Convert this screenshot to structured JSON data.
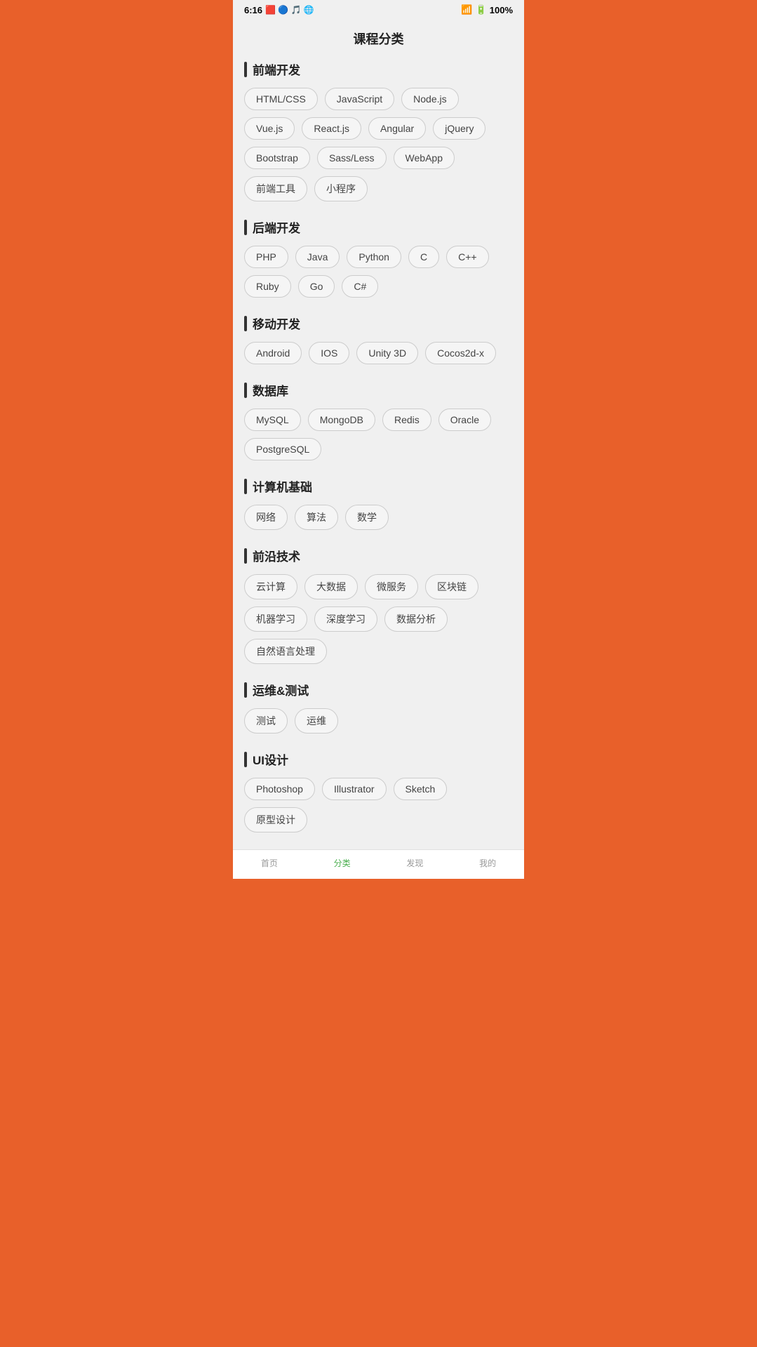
{
  "statusBar": {
    "time": "6:16",
    "battery": "100%"
  },
  "pageTitle": "课程分类",
  "sections": [
    {
      "id": "frontend",
      "title": "前端开发",
      "tags": [
        "HTML/CSS",
        "JavaScript",
        "Node.js",
        "Vue.js",
        "React.js",
        "Angular",
        "jQuery",
        "Bootstrap",
        "Sass/Less",
        "WebApp",
        "前端工具",
        "小程序"
      ]
    },
    {
      "id": "backend",
      "title": "后端开发",
      "tags": [
        "PHP",
        "Java",
        "Python",
        "C",
        "C++",
        "Ruby",
        "Go",
        "C#"
      ]
    },
    {
      "id": "mobile",
      "title": "移动开发",
      "tags": [
        "Android",
        "IOS",
        "Unity 3D",
        "Cocos2d-x"
      ]
    },
    {
      "id": "database",
      "title": "数据库",
      "tags": [
        "MySQL",
        "MongoDB",
        "Redis",
        "Oracle",
        "PostgreSQL"
      ]
    },
    {
      "id": "cs-basics",
      "title": "计算机基础",
      "tags": [
        "网络",
        "算法",
        "数学"
      ]
    },
    {
      "id": "frontier",
      "title": "前沿技术",
      "tags": [
        "云计算",
        "大数据",
        "微服务",
        "区块链",
        "机器学习",
        "深度学习",
        "数据分析",
        "自然语言处理"
      ]
    },
    {
      "id": "devops",
      "title": "运维&测试",
      "tags": [
        "测试",
        "运维"
      ]
    },
    {
      "id": "ui",
      "title": "UI设计",
      "tags": [
        "Photoshop",
        "Illustrator",
        "Sketch",
        "原型设计"
      ]
    }
  ],
  "bottomNav": [
    {
      "id": "home",
      "label": "首页",
      "active": false
    },
    {
      "id": "category",
      "label": "分类",
      "active": true
    },
    {
      "id": "discover",
      "label": "发现",
      "active": false
    },
    {
      "id": "mine",
      "label": "我的",
      "active": false
    }
  ]
}
